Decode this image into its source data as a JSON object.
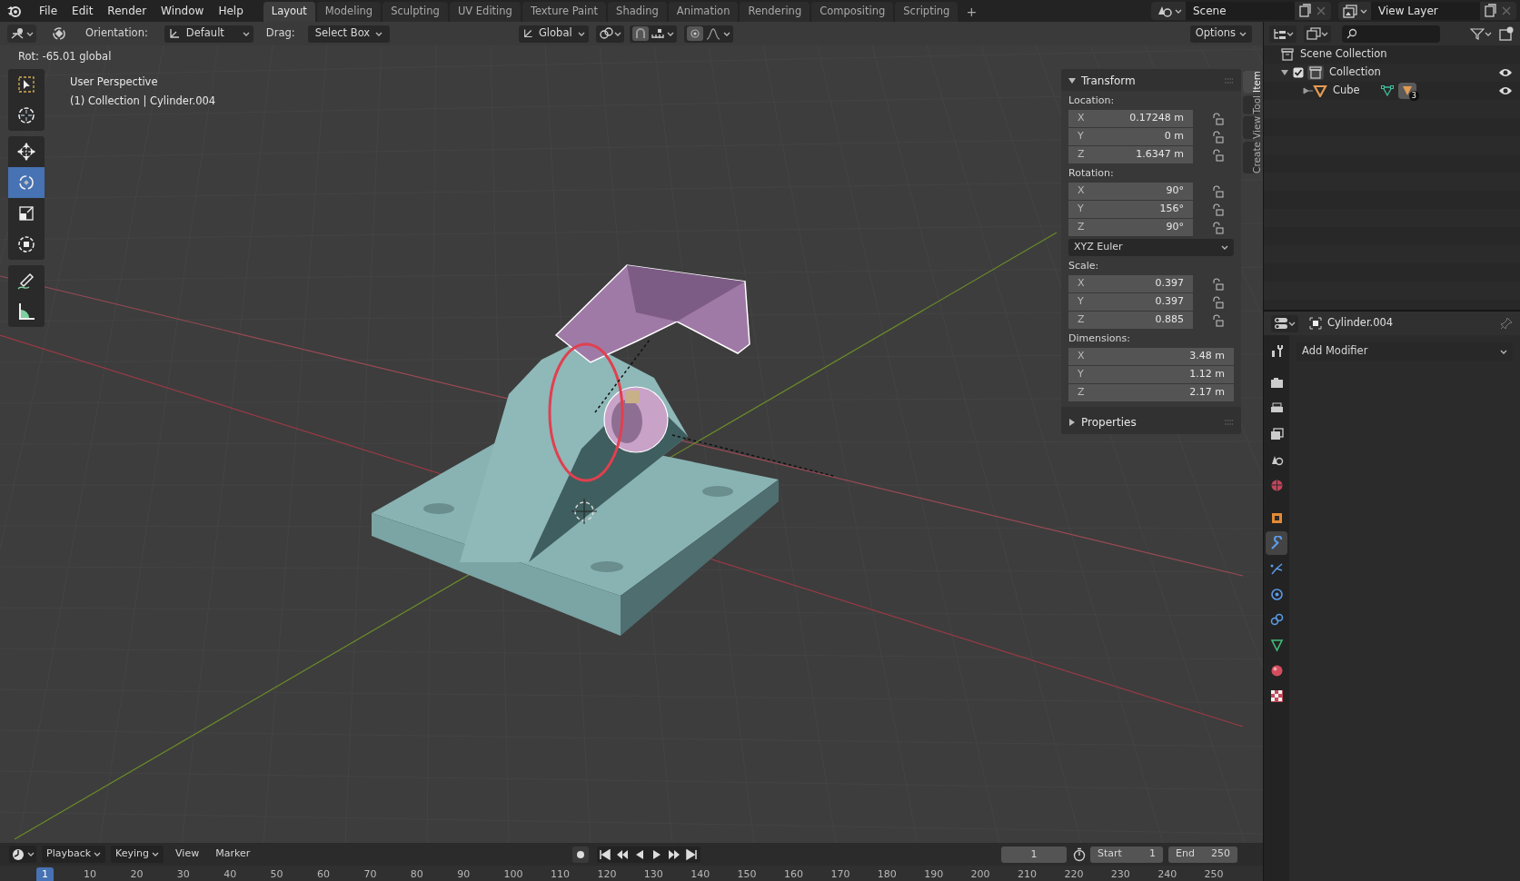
{
  "menu": [
    "File",
    "Edit",
    "Render",
    "Window",
    "Help"
  ],
  "workspaces": [
    {
      "label": "Layout",
      "selected": true
    },
    {
      "label": "Modeling",
      "selected": false
    },
    {
      "label": "Sculpting",
      "selected": false
    },
    {
      "label": "UV Editing",
      "selected": false
    },
    {
      "label": "Texture Paint",
      "selected": false
    },
    {
      "label": "Shading",
      "selected": false
    },
    {
      "label": "Animation",
      "selected": false
    },
    {
      "label": "Rendering",
      "selected": false
    },
    {
      "label": "Compositing",
      "selected": false
    },
    {
      "label": "Scripting",
      "selected": false
    }
  ],
  "add_workspace": "+",
  "scene": "Scene",
  "view_layer": "View Layer",
  "header": {
    "orientation_label": "Orientation:",
    "orientation": "Default",
    "drag_label": "Drag:",
    "drag": "Select Box",
    "transform_orientation": "Global",
    "options": "Options"
  },
  "viewport": {
    "operator_status": "Rot: -65.01 global",
    "view_name": "User Perspective",
    "object_info": "(1) Collection | Cylinder.004"
  },
  "tools": [
    {
      "kind": "select",
      "selected": false
    },
    {
      "kind": "cursor",
      "selected": false
    },
    {
      "kind": "move",
      "selected": false
    },
    {
      "kind": "rotate",
      "selected": true
    },
    {
      "kind": "scale",
      "selected": false
    },
    {
      "kind": "transform",
      "selected": false
    },
    {
      "kind": "annotate",
      "selected": false
    },
    {
      "kind": "measure",
      "selected": false
    }
  ],
  "sidebar_tabs": [
    {
      "label": "Item",
      "selected": true
    },
    {
      "label": "Tool",
      "selected": false
    },
    {
      "label": "View",
      "selected": false
    },
    {
      "label": "Create",
      "selected": false
    }
  ],
  "transform_panel": {
    "title": "Transform",
    "expanded": true,
    "groups": [
      {
        "label": "Location:",
        "locks": true,
        "rows": [
          {
            "axis": "X",
            "value": "0.17248 m"
          },
          {
            "axis": "Y",
            "value": "0 m"
          },
          {
            "axis": "Z",
            "value": "1.6347 m"
          }
        ]
      },
      {
        "label": "Rotation:",
        "locks": true,
        "rows": [
          {
            "axis": "X",
            "value": "90°"
          },
          {
            "axis": "Y",
            "value": "156°"
          },
          {
            "axis": "Z",
            "value": "90°"
          }
        ],
        "mode": "XYZ Euler"
      },
      {
        "label": "Scale:",
        "locks": true,
        "rows": [
          {
            "axis": "X",
            "value": "0.397"
          },
          {
            "axis": "Y",
            "value": "0.397"
          },
          {
            "axis": "Z",
            "value": "0.885"
          }
        ]
      },
      {
        "label": "Dimensions:",
        "locks": false,
        "rows": [
          {
            "axis": "X",
            "value": "3.48 m"
          },
          {
            "axis": "Y",
            "value": "1.12 m"
          },
          {
            "axis": "Z",
            "value": "2.17 m"
          }
        ]
      }
    ]
  },
  "properties_panel": {
    "title": "Properties",
    "expanded": false
  },
  "outliner": {
    "items": [
      {
        "label": "Scene Collection",
        "kind": "scene",
        "children": [
          {
            "label": "Collection",
            "kind": "collection",
            "checked": true,
            "visible": true,
            "expanded": true,
            "children": [
              {
                "label": "Cube",
                "kind": "object",
                "visible": true,
                "expanded": false,
                "badge": "3"
              }
            ]
          }
        ]
      }
    ]
  },
  "properties": {
    "object_name": "Cylinder.004",
    "add_modifier": "Add Modifier",
    "tabs": [
      {
        "kind": "tool",
        "selected": false
      },
      {
        "kind": "render",
        "selected": false
      },
      {
        "kind": "output",
        "selected": false
      },
      {
        "kind": "view_layer",
        "selected": false
      },
      {
        "kind": "scene",
        "selected": false
      },
      {
        "kind": "world",
        "selected": false
      },
      {
        "kind": "object",
        "selected": false
      },
      {
        "kind": "modifier",
        "selected": true
      },
      {
        "kind": "particles",
        "selected": false
      },
      {
        "kind": "physics",
        "selected": false
      },
      {
        "kind": "constraints",
        "selected": false
      },
      {
        "kind": "data",
        "selected": false
      },
      {
        "kind": "material",
        "selected": false
      },
      {
        "kind": "texture",
        "selected": false
      }
    ]
  },
  "timeline": {
    "menus": [
      "Playback",
      "Keying",
      "View",
      "Marker"
    ],
    "current_frame": "1",
    "start_label": "Start",
    "start": "1",
    "end_label": "End",
    "end": "250",
    "ticks": [
      {
        "label": "1",
        "selected": true
      },
      {
        "label": "10",
        "selected": false
      },
      {
        "label": "20",
        "selected": false
      },
      {
        "label": "30",
        "selected": false
      },
      {
        "label": "40",
        "selected": false
      },
      {
        "label": "50",
        "selected": false
      },
      {
        "label": "60",
        "selected": false
      },
      {
        "label": "70",
        "selected": false
      },
      {
        "label": "80",
        "selected": false
      },
      {
        "label": "90",
        "selected": false
      },
      {
        "label": "100",
        "selected": false
      },
      {
        "label": "110",
        "selected": false
      },
      {
        "label": "120",
        "selected": false
      },
      {
        "label": "130",
        "selected": false
      },
      {
        "label": "140",
        "selected": false
      },
      {
        "label": "150",
        "selected": false
      },
      {
        "label": "160",
        "selected": false
      },
      {
        "label": "170",
        "selected": false
      },
      {
        "label": "180",
        "selected": false
      },
      {
        "label": "190",
        "selected": false
      },
      {
        "label": "200",
        "selected": false
      },
      {
        "label": "210",
        "selected": false
      },
      {
        "label": "220",
        "selected": false
      },
      {
        "label": "230",
        "selected": false
      },
      {
        "label": "240",
        "selected": false
      },
      {
        "label": "250",
        "selected": false
      }
    ]
  }
}
